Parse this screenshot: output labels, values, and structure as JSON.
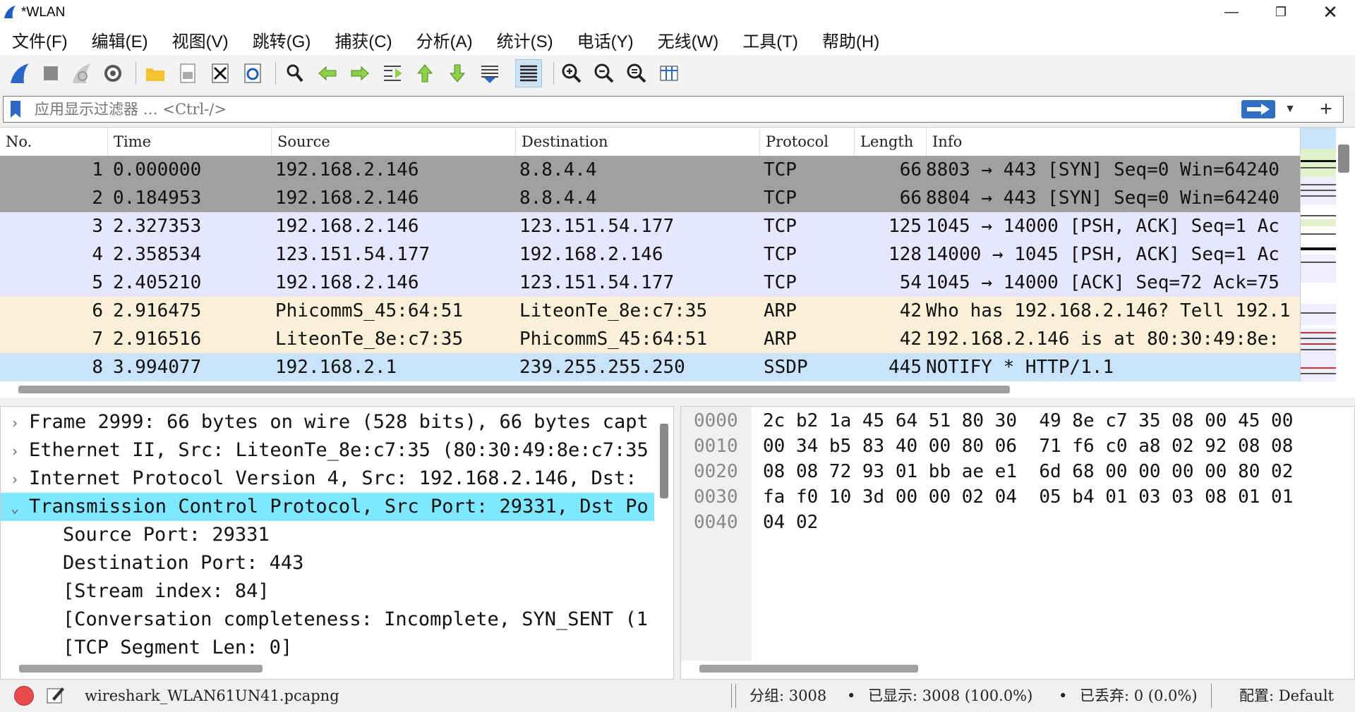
{
  "window": {
    "title": "*WLAN",
    "minimize_icon": "minimize-icon",
    "maximize_icon": "restore-icon",
    "close_icon": "close-icon"
  },
  "menu": [
    {
      "label": "文件(F)"
    },
    {
      "label": "编辑(E)"
    },
    {
      "label": "视图(V)"
    },
    {
      "label": "跳转(G)"
    },
    {
      "label": "捕获(C)"
    },
    {
      "label": "分析(A)"
    },
    {
      "label": "统计(S)"
    },
    {
      "label": "电话(Y)"
    },
    {
      "label": "无线(W)"
    },
    {
      "label": "工具(T)"
    },
    {
      "label": "帮助(H)"
    }
  ],
  "toolbar": {
    "icons": [
      "start-capture-icon",
      "stop-capture-icon",
      "restart-capture-icon",
      "capture-options-icon",
      "open-file-icon",
      "save-file-icon",
      "close-file-icon",
      "reload-icon",
      "find-packet-icon",
      "go-back-icon",
      "go-forward-icon",
      "go-to-packet-icon",
      "first-packet-icon",
      "last-packet-icon",
      "auto-scroll-icon",
      "colorize-icon",
      "zoom-in-icon",
      "zoom-out-icon",
      "normal-size-icon",
      "resize-columns-icon"
    ],
    "active": "colorize-icon"
  },
  "filter": {
    "placeholder": "应用显示过滤器 … <Ctrl-/>",
    "value": ""
  },
  "packet_list": {
    "columns": [
      "No.",
      "Time",
      "Source",
      "Destination",
      "Protocol",
      "Length",
      "Info"
    ],
    "rows": [
      {
        "no": "1",
        "time": "0.000000",
        "src": "192.168.2.146",
        "dst": "8.8.4.4",
        "proto": "TCP",
        "len": "66",
        "info": "8803 → 443 [SYN] Seq=0 Win=64240",
        "bg": "#a0a0a0"
      },
      {
        "no": "2",
        "time": "0.184953",
        "src": "192.168.2.146",
        "dst": "8.8.4.4",
        "proto": "TCP",
        "len": "66",
        "info": "8804 → 443 [SYN] Seq=0 Win=64240",
        "bg": "#a0a0a0"
      },
      {
        "no": "3",
        "time": "2.327353",
        "src": "192.168.2.146",
        "dst": "123.151.54.177",
        "proto": "TCP",
        "len": "125",
        "info": "1045 → 14000 [PSH, ACK] Seq=1 Ac",
        "bg": "#e7e6ff"
      },
      {
        "no": "4",
        "time": "2.358534",
        "src": "123.151.54.177",
        "dst": "192.168.2.146",
        "proto": "TCP",
        "len": "128",
        "info": "14000 → 1045 [PSH, ACK] Seq=1 Ac",
        "bg": "#e7e6ff"
      },
      {
        "no": "5",
        "time": "2.405210",
        "src": "192.168.2.146",
        "dst": "123.151.54.177",
        "proto": "TCP",
        "len": "54",
        "info": "1045 → 14000 [ACK] Seq=72 Ack=75",
        "bg": "#e7e6ff"
      },
      {
        "no": "6",
        "time": "2.916475",
        "src": "PhicommS_45:64:51",
        "dst": "LiteonTe_8e:c7:35",
        "proto": "ARP",
        "len": "42",
        "info": "Who has 192.168.2.146? Tell 192.1",
        "bg": "#faf0d7"
      },
      {
        "no": "7",
        "time": "2.916516",
        "src": "LiteonTe_8e:c7:35",
        "dst": "PhicommS_45:64:51",
        "proto": "ARP",
        "len": "42",
        "info": "192.168.2.146 is at 80:30:49:8e:",
        "bg": "#faf0d7"
      },
      {
        "no": "8",
        "time": "3.994077",
        "src": "192.168.2.1",
        "dst": "239.255.255.250",
        "proto": "SSDP",
        "len": "445",
        "info": "NOTIFY * HTTP/1.1",
        "bg": "#c8e3fa"
      }
    ]
  },
  "details": {
    "lines": [
      {
        "arrow": "›",
        "text": "Frame 2999: 66 bytes on wire (528 bits), 66 bytes capt",
        "indent": 0,
        "selected": false
      },
      {
        "arrow": "›",
        "text": "Ethernet II, Src: LiteonTe_8e:c7:35 (80:30:49:8e:c7:35",
        "indent": 0,
        "selected": false
      },
      {
        "arrow": "›",
        "text": "Internet Protocol Version 4, Src: 192.168.2.146, Dst: ",
        "indent": 0,
        "selected": false
      },
      {
        "arrow": "⌄",
        "text": "Transmission Control Protocol, Src Port: 29331, Dst Po",
        "indent": 0,
        "selected": true
      },
      {
        "arrow": "",
        "text": "Source Port: 29331",
        "indent": 1,
        "selected": false
      },
      {
        "arrow": "",
        "text": "Destination Port: 443",
        "indent": 1,
        "selected": false
      },
      {
        "arrow": "",
        "text": "[Stream index: 84]",
        "indent": 1,
        "selected": false
      },
      {
        "arrow": "",
        "text": "[Conversation completeness: Incomplete, SYN_SENT (1",
        "indent": 1,
        "selected": false
      },
      {
        "arrow": "",
        "text": "[TCP Segment Len: 0]",
        "indent": 1,
        "selected": false
      }
    ]
  },
  "bytes": {
    "lines": [
      {
        "offset": "0000",
        "hex": "2c b2 1a 45 64 51 80 30  49 8e c7 35 08 00 45 00"
      },
      {
        "offset": "0010",
        "hex": "00 34 b5 83 40 00 80 06  71 f6 c0 a8 02 92 08 08"
      },
      {
        "offset": "0020",
        "hex": "08 08 72 93 01 bb ae e1  6d 68 00 00 00 00 80 02"
      },
      {
        "offset": "0030",
        "hex": "fa f0 10 3d 00 00 02 04  05 b4 01 03 03 08 01 01"
      },
      {
        "offset": "0040",
        "hex": "04 02"
      }
    ]
  },
  "status": {
    "file": "wireshark_WLAN61UN41.pcapng",
    "packets": "分组: 3008",
    "displayed": "已显示: 3008 (100.0%)",
    "dropped": "已丢弃: 0 (0.0%)",
    "profile": "配置: Default"
  }
}
